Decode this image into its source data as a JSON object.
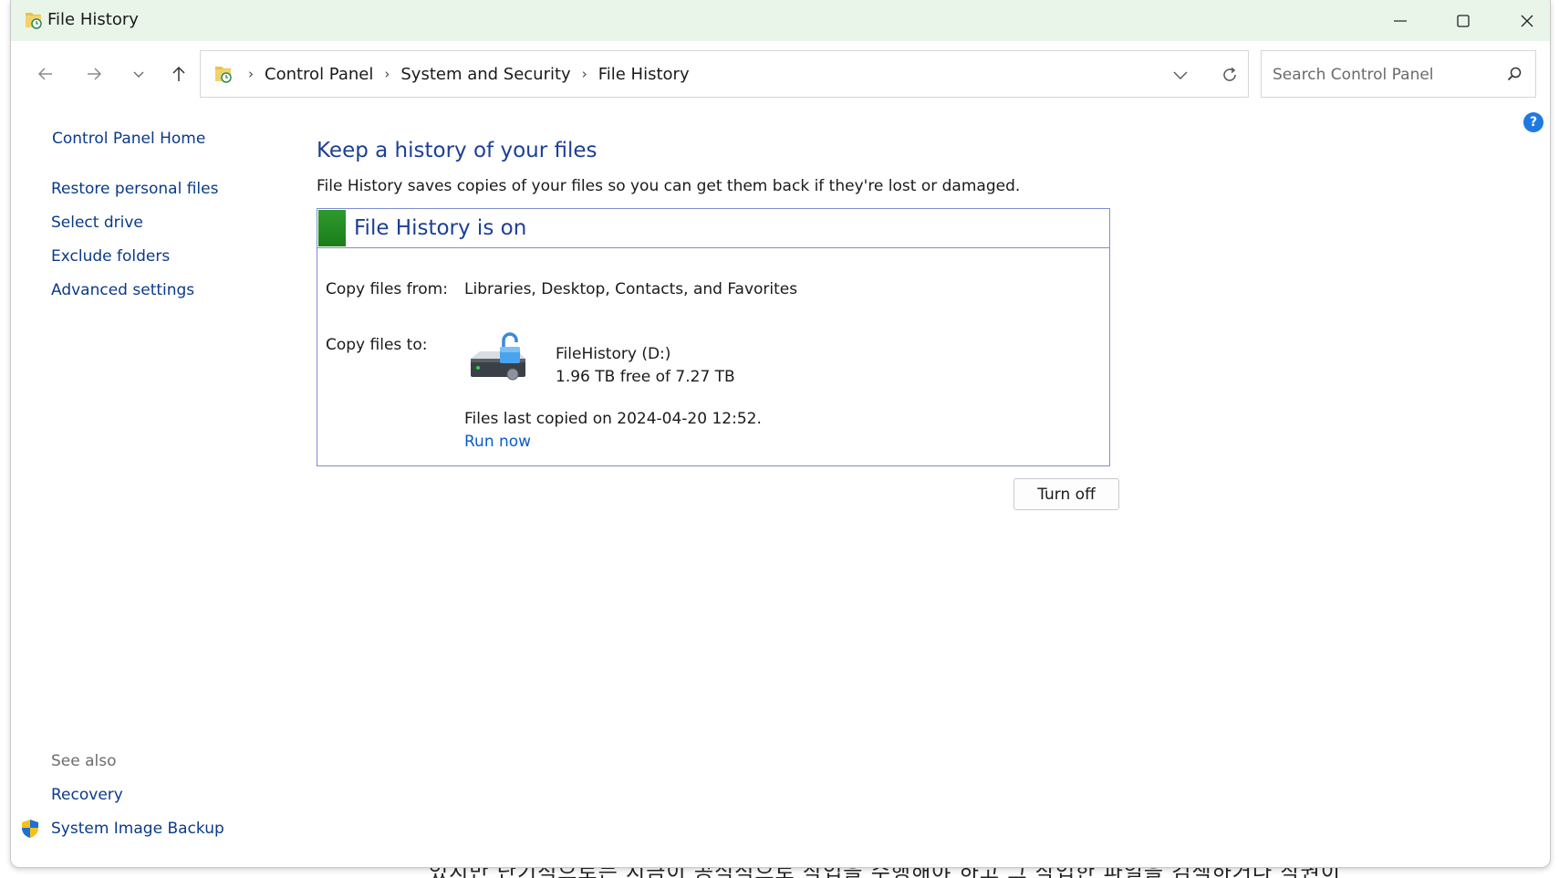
{
  "backdrop": {
    "text": "었지만 단기적으로는 지금이 공식적으로 작업을 수행해야 하고 그 작업한 파일을 검색하거나 작권이"
  },
  "window": {
    "title": "File History",
    "controls": {
      "minimize": "minimize-icon",
      "maximize": "maximize-icon",
      "close": "close-icon"
    }
  },
  "nav": {
    "breadcrumb": [
      "Control Panel",
      "System and Security",
      "File History"
    ]
  },
  "search": {
    "placeholder": "Search Control Panel"
  },
  "sidebar": {
    "home": "Control Panel Home",
    "links": [
      "Restore personal files",
      "Select drive",
      "Exclude folders",
      "Advanced settings"
    ],
    "see_also_label": "See also",
    "see_also": [
      "Recovery",
      "System Image Backup"
    ]
  },
  "main": {
    "heading": "Keep a history of your files",
    "description": "File History saves copies of your files so you can get them back if they're lost or damaged.",
    "status": {
      "title": "File History is on",
      "copy_from_label": "Copy files from:",
      "copy_from_value": "Libraries, Desktop, Contacts, and Favorites",
      "copy_to_label": "Copy files to:",
      "drive_name": "FileHistory (D:)",
      "drive_space": "1.96 TB free of 7.27 TB",
      "last_copied": "Files last copied on 2024-04-20 12:52.",
      "run_now": "Run now"
    },
    "turn_off_label": "Turn off"
  },
  "colors": {
    "titlebar": "#eaf5ea",
    "link": "#0b3a8a",
    "heading": "#1c3f95",
    "status_on": "#2e9a2e",
    "box_border": "#7f8dd0"
  }
}
